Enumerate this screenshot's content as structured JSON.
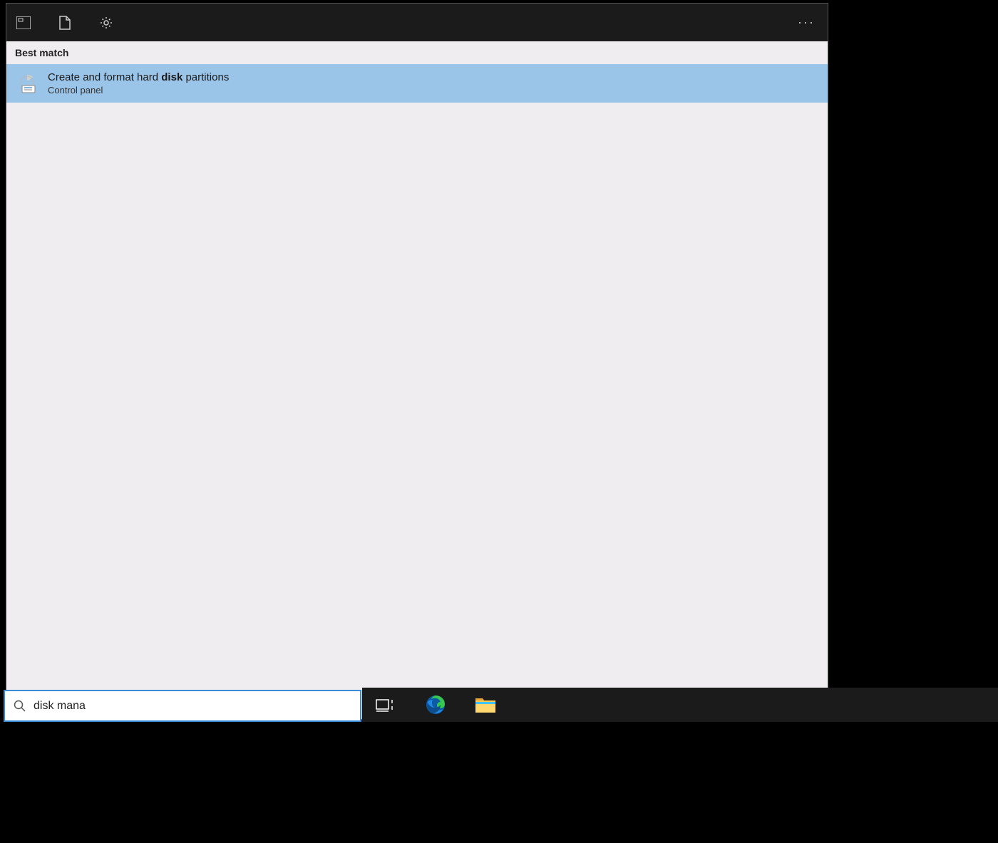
{
  "header": {
    "icons": [
      "apps-icon",
      "documents-icon",
      "settings-icon"
    ],
    "more": "···"
  },
  "section_label": "Best match",
  "result": {
    "title_pre": "Create and format hard ",
    "title_bold": "disk",
    "title_post": " partitions",
    "subtitle": "Control panel"
  },
  "search": {
    "value": "disk mana"
  },
  "taskbar": {
    "icons": [
      "task-view-icon",
      "edge-icon",
      "file-explorer-icon"
    ]
  }
}
